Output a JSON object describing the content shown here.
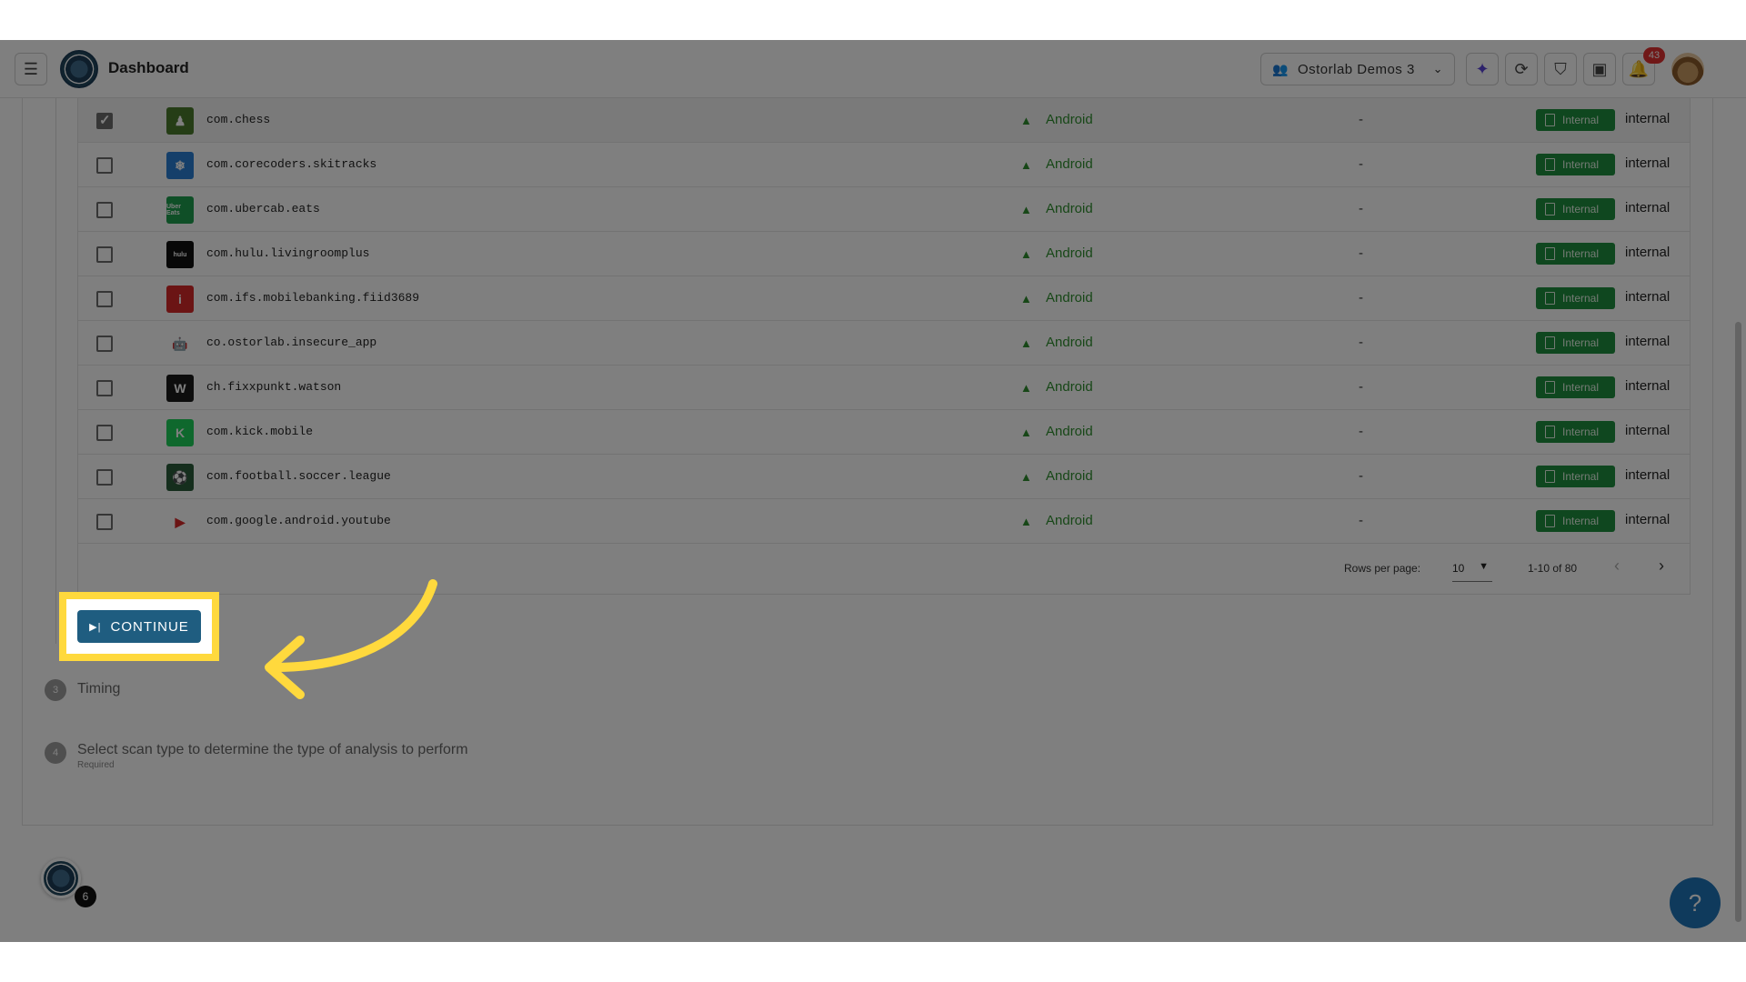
{
  "header": {
    "title": "Dashboard",
    "org_name": "Ostorlab Demos 3",
    "notification_count": "43"
  },
  "table": {
    "rows": [
      {
        "package": "com.chess",
        "platform": "Android",
        "version": "-",
        "tag": "Internal",
        "visibility": "internal",
        "checked": true,
        "icon_color": "#4a7a2c",
        "icon_glyph": "♟"
      },
      {
        "package": "com.corecoders.skitracks",
        "platform": "Android",
        "version": "-",
        "tag": "Internal",
        "visibility": "internal",
        "checked": false,
        "icon_color": "#2a7fd4",
        "icon_glyph": "❄"
      },
      {
        "package": "com.ubercab.eats",
        "platform": "Android",
        "version": "-",
        "tag": "Internal",
        "visibility": "internal",
        "checked": false,
        "icon_color": "#1e9e4e",
        "icon_glyph": "Uber Eats"
      },
      {
        "package": "com.hulu.livingroomplus",
        "platform": "Android",
        "version": "-",
        "tag": "Internal",
        "visibility": "internal",
        "checked": false,
        "icon_color": "#111111",
        "icon_glyph": "hulu"
      },
      {
        "package": "com.ifs.mobilebanking.fiid3689",
        "platform": "Android",
        "version": "-",
        "tag": "Internal",
        "visibility": "internal",
        "checked": false,
        "icon_color": "#d62828",
        "icon_glyph": "i"
      },
      {
        "package": "co.ostorlab.insecure_app",
        "platform": "Android",
        "version": "-",
        "tag": "Internal",
        "visibility": "internal",
        "checked": false,
        "icon_color": "#ffffff",
        "icon_glyph": "🤖"
      },
      {
        "package": "ch.fixxpunkt.watson",
        "platform": "Android",
        "version": "-",
        "tag": "Internal",
        "visibility": "internal",
        "checked": false,
        "icon_color": "#1a1a1a",
        "icon_glyph": "W"
      },
      {
        "package": "com.kick.mobile",
        "platform": "Android",
        "version": "-",
        "tag": "Internal",
        "visibility": "internal",
        "checked": false,
        "icon_color": "#1fd15a",
        "icon_glyph": "K"
      },
      {
        "package": "com.football.soccer.league",
        "platform": "Android",
        "version": "-",
        "tag": "Internal",
        "visibility": "internal",
        "checked": false,
        "icon_color": "#2b5d3a",
        "icon_glyph": "⚽"
      },
      {
        "package": "com.google.android.youtube",
        "platform": "Android",
        "version": "-",
        "tag": "Internal",
        "visibility": "internal",
        "checked": false,
        "icon_color": "#ffffff",
        "icon_glyph": "▶"
      }
    ]
  },
  "pagination": {
    "rows_per_page_label": "Rows per page:",
    "rows_per_page": "10",
    "range": "1-10 of 80"
  },
  "actions": {
    "continue_label": "CONTINUE"
  },
  "steps": {
    "step3_num": "3",
    "step3_label": "Timing",
    "step4_num": "4",
    "step4_label": "Select scan type to determine the type of analysis to perform",
    "step4_sub": "Required"
  },
  "floating": {
    "queue_count": "6",
    "help_label": "?"
  },
  "colors": {
    "accent": "#1f5d80",
    "highlight": "#ffd93d",
    "android_green": "#2f8f2f",
    "tag_green": "#1e8e3e",
    "badge_red": "#e03131"
  }
}
